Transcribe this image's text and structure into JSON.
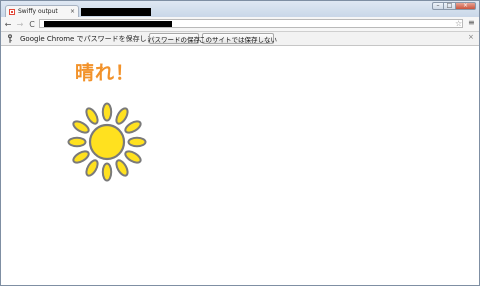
{
  "browser": {
    "tab": {
      "title": "Swiffy output",
      "close_glyph": "×"
    },
    "window_controls": {
      "minimize": "–",
      "maximize": "□",
      "close": "×"
    },
    "toolbar": {
      "back": "←",
      "forward": "→",
      "reload": "C",
      "star": "☆",
      "menu": "≡"
    },
    "infobar": {
      "message": "Google Chrome でパスワードを保存しますか？",
      "save_label": "パスワードの保存",
      "never_label": "このサイトでは保存しない",
      "close_glyph": "×"
    }
  },
  "content": {
    "weather_text": "晴れ！",
    "icon": "sun-icon",
    "colors": {
      "text": "#f2922a",
      "sun_fill": "#ffe11f",
      "sun_stroke": "#7a7a7a"
    }
  }
}
